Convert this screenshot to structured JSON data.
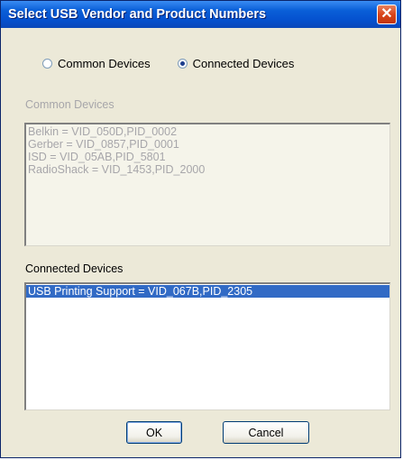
{
  "window": {
    "title": "Select USB Vendor and Product Numbers",
    "close_symbol": "✕"
  },
  "radio": {
    "common_label": "Common Devices",
    "connected_label": "Connected Devices",
    "selected": "connected"
  },
  "common_group": {
    "label": "Common Devices",
    "items": [
      "Belkin = VID_050D,PID_0002",
      "Gerber = VID_0857,PID_0001",
      "ISD = VID_05AB,PID_5801",
      "RadioShack = VID_1453,PID_2000"
    ]
  },
  "connected_group": {
    "label": "Connected Devices",
    "items": [
      "USB Printing Support = VID_067B,PID_2305"
    ],
    "selected_index": 0
  },
  "buttons": {
    "ok": "OK",
    "cancel": "Cancel"
  },
  "colors": {
    "title_bar": "#0551cf",
    "selection": "#316ac5",
    "disabled_text": "#a7a6aa",
    "dialog_bg": "#ece9d8"
  },
  "icons": {
    "close": "close-icon",
    "radio_unchecked": "radio-unchecked-icon",
    "radio_checked": "radio-checked-icon"
  }
}
